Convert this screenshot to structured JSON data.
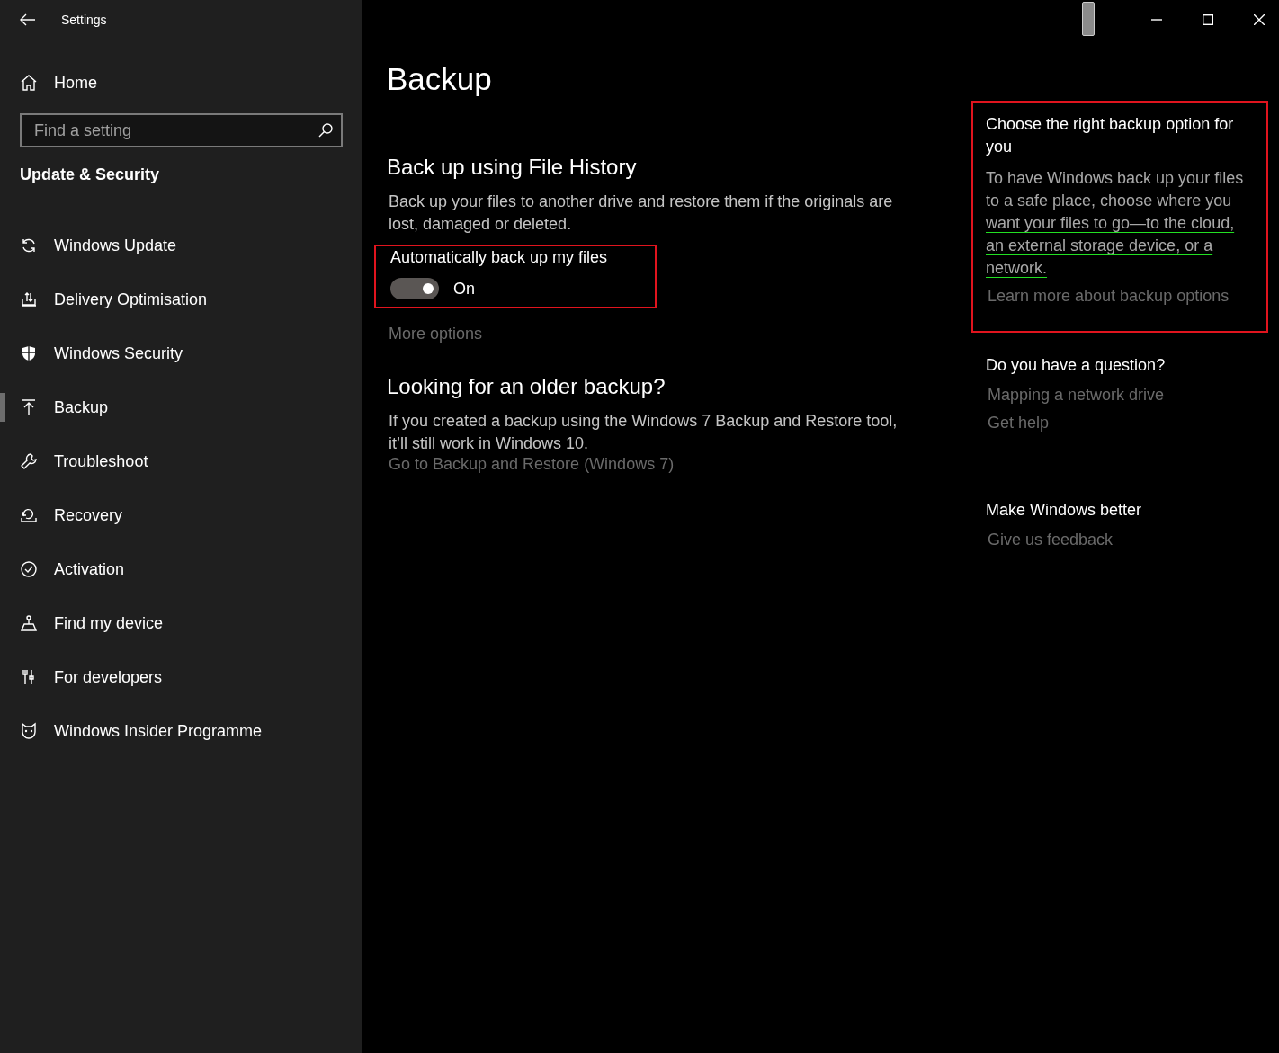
{
  "window": {
    "title": "Settings"
  },
  "sidebar": {
    "home": "Home",
    "search": {
      "placeholder": "Find a setting"
    },
    "section": "Update & Security",
    "items": [
      {
        "label": "Windows Update",
        "selected": false
      },
      {
        "label": "Delivery Optimisation",
        "selected": false
      },
      {
        "label": "Windows Security",
        "selected": false
      },
      {
        "label": "Backup",
        "selected": true
      },
      {
        "label": "Troubleshoot",
        "selected": false
      },
      {
        "label": "Recovery",
        "selected": false
      },
      {
        "label": "Activation",
        "selected": false
      },
      {
        "label": "Find my device",
        "selected": false
      },
      {
        "label": "For developers",
        "selected": false
      },
      {
        "label": "Windows Insider Programme",
        "selected": false
      }
    ]
  },
  "page": {
    "title": "Backup",
    "file_history": {
      "heading": "Back up using File History",
      "description": "Back up your files to another drive and restore them if the originals are lost, damaged or deleted.",
      "toggle": {
        "label": "Automatically back up my files",
        "on": true,
        "state_text": "On",
        "annotated": true
      },
      "link": "More options"
    },
    "older": {
      "heading": "Looking for an older backup?",
      "description": "If you created a backup using the Windows 7 Backup and Restore tool, it’ll still work in Windows 10.",
      "link": "Go to Backup and Restore (Windows 7)"
    }
  },
  "aside": [
    {
      "heading": "Choose the right backup option for you",
      "body": "To have Windows back up your files to a safe place, ",
      "underlined": "choose where you want your files to go—to the cloud, an external storage device, or a network.",
      "links": [
        "Learn more about backup options"
      ],
      "annotated": true
    },
    {
      "heading": "Do you have a question?",
      "links": [
        "Mapping a network drive",
        "Get help"
      ],
      "annotated": false
    },
    {
      "heading": "Make Windows better",
      "links": [
        "Give us feedback"
      ],
      "annotated": false
    }
  ]
}
